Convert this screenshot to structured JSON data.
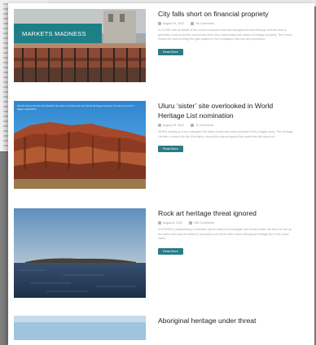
{
  "posts": [
    {
      "title": "City falls short on financial propriety",
      "overlay": "MARKETS MADNESS",
      "date": "August 29, 2022",
      "comments": "No Comments",
      "excerpt": "A CLOSE look at details of the current council's financial management and dealings reveals what is generally a sound but the council has been less forthcoming with cases of heritage property. The review shows the need to bring the gate system in full compliance with the new procedure.",
      "button": "Read More"
    },
    {
      "title": "Uluru ‘sister’ site overlooked in World Heritage List nomination",
      "caption": "Shortly before the list was finalized the state nominated its own World Heritage listing for the site as part of a bigger application.",
      "date": "August 29, 2022",
      "comments": "11 Comments",
      "excerpt": "WHEN looking at a few examples, the state would have been pressed to tell a bigger story. The Heritage List item, tucked into the Murchison, shows the natural assets that make this site stand out.",
      "button": "Read More"
    },
    {
      "title": "Rock art heritage threat ignored",
      "date": "August 8, 2022",
      "comments": "256 Comments",
      "excerpt": "A FEDERAL parliamentary committee will be asked to investigate new issues under the Rock Art Act as the nation will soon be asked to document over these sites where Aboriginal heritage lies in the same frame.",
      "button": "Read More"
    },
    {
      "title": "Aboriginal heritage under threat"
    }
  ]
}
